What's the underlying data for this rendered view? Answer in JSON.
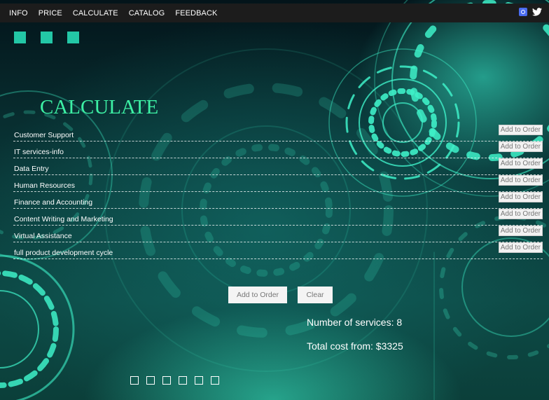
{
  "nav": {
    "items": [
      "INFO",
      "PRICE",
      "CALCULATE",
      "CATALOG",
      "FEEDBACK"
    ],
    "social_icons": [
      "instagram-icon",
      "twitter-icon"
    ]
  },
  "page": {
    "title": "CALCULATE"
  },
  "services": [
    {
      "name": "Customer Support",
      "button": "Add to Order"
    },
    {
      "name": "IT services-info",
      "button": "Add to Order"
    },
    {
      "name": "Data Entry",
      "button": "Add to Order"
    },
    {
      "name": "Human Resources",
      "button": "Add to Order"
    },
    {
      "name": "Finance and Accounting",
      "button": "Add to Order"
    },
    {
      "name": "Content Writing and Marketing",
      "button": "Add to Order"
    },
    {
      "name": "Virtual Assistance",
      "button": "Add to Order"
    },
    {
      "name": "full product development cycle",
      "button": "Add to Order"
    }
  ],
  "actions": {
    "add_label": "Add to Order",
    "clear_label": "Clear"
  },
  "summary": {
    "count_text": "Number of services: 8",
    "total_text": "Total cost from: $3325"
  },
  "colors": {
    "accent": "#3df1a5",
    "squares": "#23c7a6",
    "topbar": "#1c1c1c"
  }
}
